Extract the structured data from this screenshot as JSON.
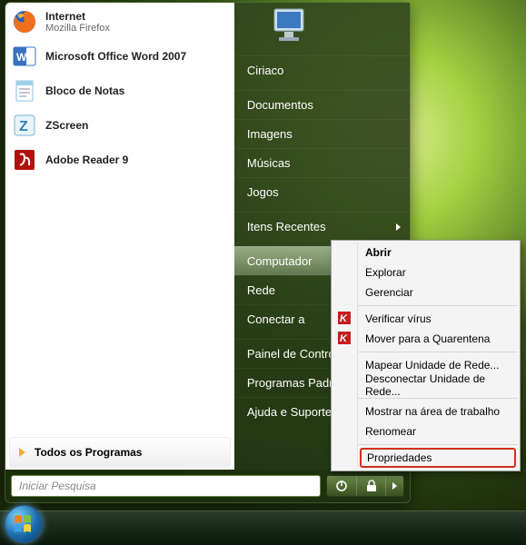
{
  "pinned": [
    {
      "title": "Internet",
      "subtitle": "Mozilla Firefox",
      "icon": "firefox-icon"
    },
    {
      "title": "Microsoft Office Word 2007",
      "subtitle": "",
      "icon": "word-icon"
    },
    {
      "title": "Bloco de Notas",
      "subtitle": "",
      "icon": "notepad-icon"
    },
    {
      "title": "ZScreen",
      "subtitle": "",
      "icon": "zscreen-icon"
    },
    {
      "title": "Adobe Reader 9",
      "subtitle": "",
      "icon": "adobe-reader-icon"
    }
  ],
  "all_programs_label": "Todos os Programas",
  "search_placeholder": "Iniciar Pesquisa",
  "right_items": [
    {
      "label": "Ciriaco",
      "submenu": false,
      "highlight": false
    },
    {
      "label": "Documentos",
      "submenu": false,
      "highlight": false
    },
    {
      "label": "Imagens",
      "submenu": false,
      "highlight": false
    },
    {
      "label": "Músicas",
      "submenu": false,
      "highlight": false
    },
    {
      "label": "Jogos",
      "submenu": false,
      "highlight": false
    },
    {
      "label": "Itens Recentes",
      "submenu": true,
      "highlight": false
    },
    {
      "label": "Computador",
      "submenu": false,
      "highlight": true
    },
    {
      "label": "Rede",
      "submenu": false,
      "highlight": false
    },
    {
      "label": "Conectar a",
      "submenu": false,
      "highlight": false
    },
    {
      "label": "Painel de Controle",
      "submenu": false,
      "highlight": false
    },
    {
      "label": "Programas Padrão",
      "submenu": false,
      "highlight": false
    },
    {
      "label": "Ajuda e Suporte",
      "submenu": false,
      "highlight": false
    }
  ],
  "context_menu": [
    {
      "label": "Abrir",
      "bold": true
    },
    {
      "label": "Explorar"
    },
    {
      "label": "Gerenciar"
    },
    {
      "sep": true
    },
    {
      "label": "Verificar vírus",
      "icon": "kaspersky-icon"
    },
    {
      "label": "Mover para a Quarentena",
      "icon": "kaspersky-icon"
    },
    {
      "sep": true
    },
    {
      "label": "Mapear Unidade de Rede..."
    },
    {
      "label": "Desconectar Unidade de Rede..."
    },
    {
      "sep": true
    },
    {
      "label": "Mostrar na área de trabalho"
    },
    {
      "label": "Renomear"
    },
    {
      "sep": true
    },
    {
      "label": "Propriedades",
      "boxed": true
    }
  ]
}
